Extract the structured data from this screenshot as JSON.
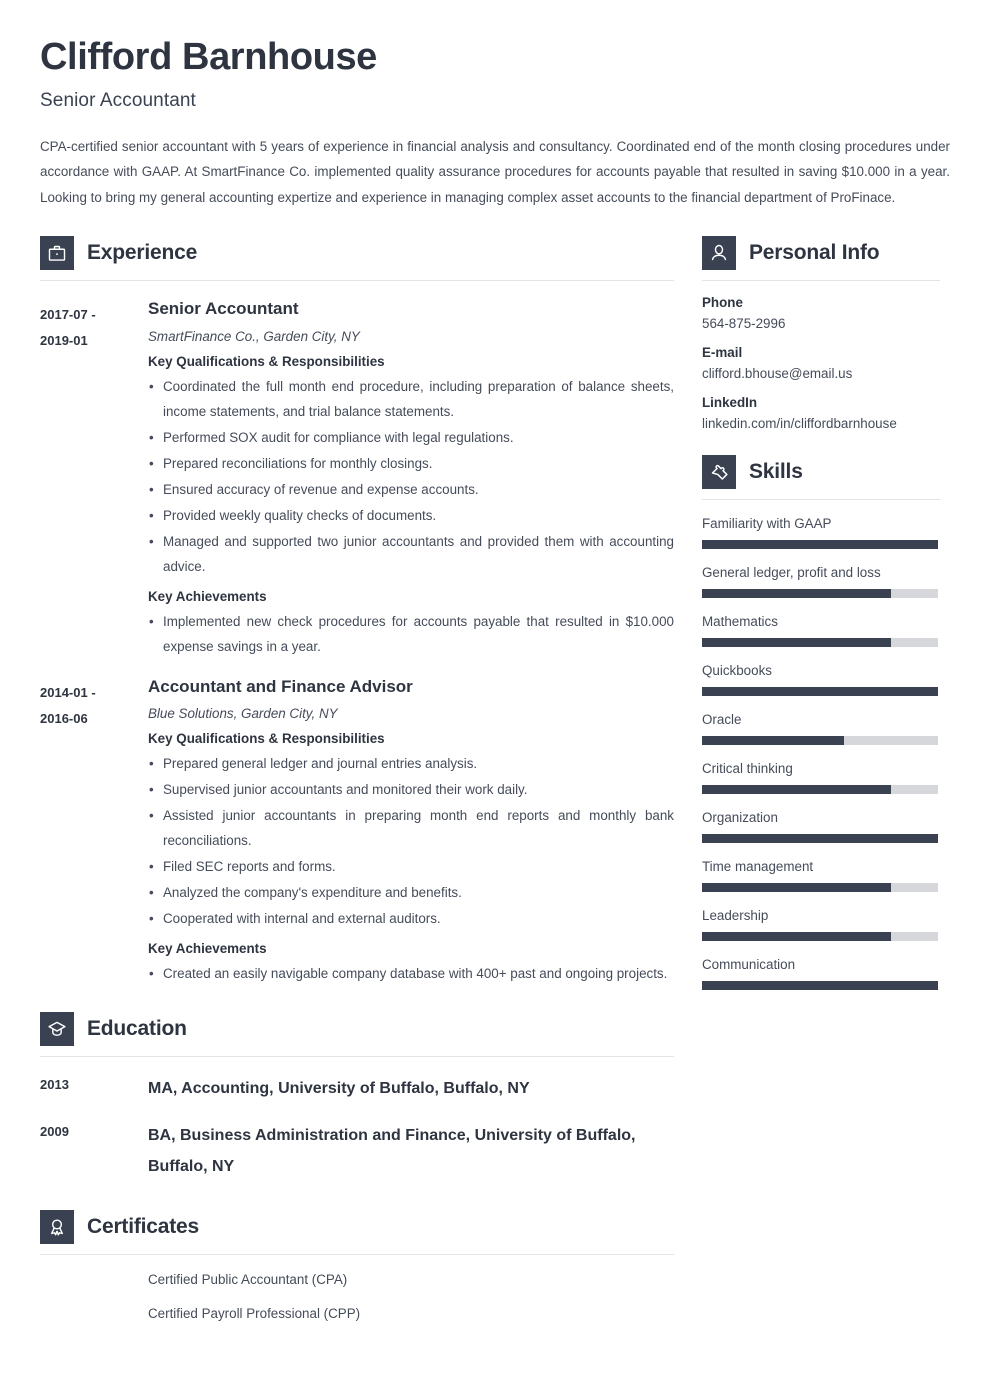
{
  "header": {
    "name": "Clifford Barnhouse",
    "job_title": "Senior Accountant",
    "summary": "CPA-certified senior accountant with 5 years of experience in financial analysis and consultancy. Coordinated end of the month closing procedures under accordance with GAAP. At SmartFinance Co. implemented quality assurance procedures for accounts payable that resulted in saving $10.000 in a year. Looking to bring my general accounting expertize and experience in managing complex asset accounts to the financial department of ProFinace."
  },
  "theme": {
    "accent_dark": "#3a4252",
    "track_gray": "#d5d7da",
    "rule_gray": "#e2e4e8",
    "text_gray": "#454c59"
  },
  "sections": {
    "experience": {
      "title": "Experience",
      "icon": "briefcase-icon",
      "jobs": [
        {
          "date_start": "2017-07 -",
          "date_end": "2019-01",
          "role": "Senior Accountant",
          "company": "SmartFinance Co., Garden City, NY",
          "qualifications_label": "Key Qualifications & Responsibilities",
          "qualifications": [
            "Coordinated the full month end procedure, including preparation of balance sheets, income statements, and trial balance statements.",
            "Performed SOX audit for compliance with legal regulations.",
            "Prepared reconciliations for monthly closings.",
            "Ensured accuracy of revenue and expense accounts.",
            "Provided weekly quality checks of documents.",
            "Managed and supported two junior accountants and provided them with accounting advice."
          ],
          "achievements_label": "Key Achievements",
          "achievements": [
            "Implemented new check procedures for accounts payable that resulted in $10.000 expense savings in a year."
          ]
        },
        {
          "date_start": "2014-01 -",
          "date_end": "2016-06",
          "role": "Accountant and Finance Advisor",
          "company": "Blue Solutions, Garden City, NY",
          "qualifications_label": "Key Qualifications & Responsibilities",
          "qualifications": [
            "Prepared general ledger and journal entries analysis.",
            "Supervised junior accountants and monitored their work daily.",
            "Assisted junior accountants in preparing month end reports and monthly bank reconciliations.",
            "Filed SEC reports and forms.",
            "Analyzed the company's expenditure and benefits.",
            "Cooperated with internal and external auditors."
          ],
          "achievements_label": "Key Achievements",
          "achievements": [
            "Created an easily navigable company database with 400+ past and ongoing projects."
          ]
        }
      ]
    },
    "education": {
      "title": "Education",
      "icon": "graduation-cap-icon",
      "entries": [
        {
          "year": "2013",
          "text": "MA, Accounting, University of Buffalo, Buffalo, NY"
        },
        {
          "year": "2009",
          "text": "BA, Business Administration and Finance, University of Buffalo, Buffalo, NY"
        }
      ]
    },
    "certificates": {
      "title": "Certificates",
      "icon": "award-ribbon-icon",
      "entries": [
        "Certified Public Accountant (CPA)",
        "Certified Payroll Professional (CPP)"
      ]
    },
    "personal_info": {
      "title": "Personal Info",
      "icon": "person-icon",
      "items": [
        {
          "label": "Phone",
          "value": "564-875-2996"
        },
        {
          "label": "E-mail",
          "value": "clifford.bhouse@email.us"
        },
        {
          "label": "LinkedIn",
          "value": "linkedin.com/in/cliffordbarnhouse"
        }
      ]
    },
    "skills": {
      "title": "Skills",
      "icon": "puzzle-piece-icon",
      "items": [
        {
          "name": "Familiarity with GAAP",
          "level": 100
        },
        {
          "name": "General ledger, profit and loss",
          "level": 80
        },
        {
          "name": "Mathematics",
          "level": 80
        },
        {
          "name": "Quickbooks",
          "level": 100
        },
        {
          "name": "Oracle",
          "level": 60
        },
        {
          "name": "Critical thinking",
          "level": 80
        },
        {
          "name": "Organization",
          "level": 100
        },
        {
          "name": "Time management",
          "level": 80
        },
        {
          "name": "Leadership",
          "level": 80
        },
        {
          "name": "Communication",
          "level": 100
        }
      ]
    }
  }
}
